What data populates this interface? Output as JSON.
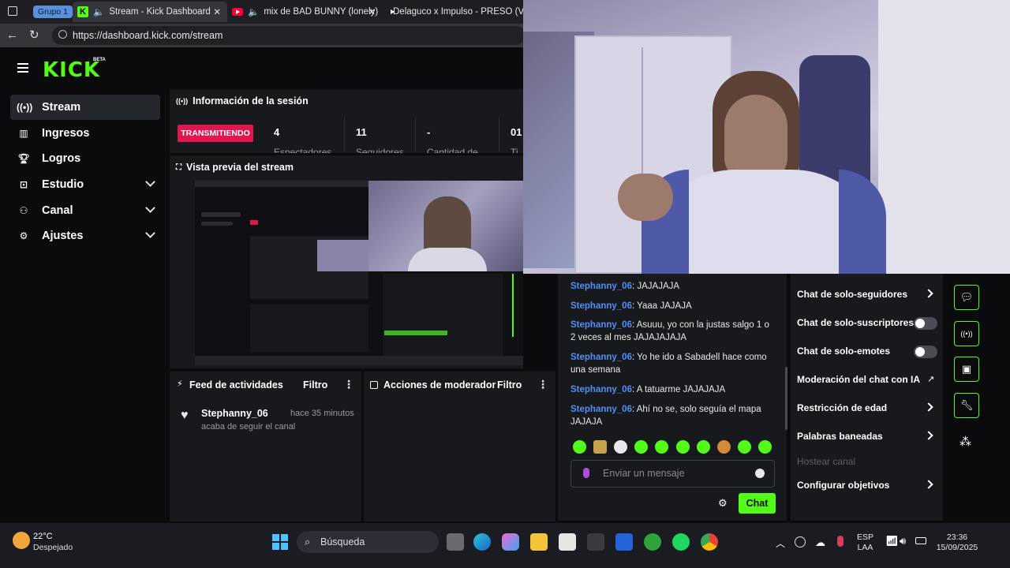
{
  "browser": {
    "group_label": "Grupo 1",
    "tabs": [
      {
        "title": "Stream - Kick Dashboard",
        "active": true
      },
      {
        "title": "mix de BAD BUNNY (lonely)"
      },
      {
        "title": "Delaguco x Impulso - PRESO (Vid"
      }
    ],
    "url": "https://dashboard.kick.com/stream"
  },
  "brand": {
    "logo": "KICK",
    "beta": "BETA",
    "accent": "#53fc18"
  },
  "sidebar": {
    "items": [
      {
        "label": "Stream",
        "icon": "broadcast-icon"
      },
      {
        "label": "Ingresos",
        "icon": "chart-icon"
      },
      {
        "label": "Logros",
        "icon": "trophy-icon"
      },
      {
        "label": "Estudio",
        "icon": "studio-icon"
      },
      {
        "label": "Canal",
        "icon": "channel-icon"
      },
      {
        "label": "Ajustes",
        "icon": "gear-icon"
      }
    ]
  },
  "session": {
    "title": "Información de la sesión",
    "status": "TRANSMITIENDO",
    "stats": [
      {
        "value": "4",
        "label": "Espectadores"
      },
      {
        "value": "11",
        "label": "Seguidores"
      },
      {
        "value": "-",
        "label": "Cantidad de"
      },
      {
        "value": "01",
        "label": "Ti"
      }
    ]
  },
  "preview": {
    "title": "Vista previa del stream"
  },
  "feed": {
    "title": "Feed de actividades",
    "filter": "Filtro",
    "items": [
      {
        "user": "Stephanny_06",
        "time": "hace 35 minutos",
        "text": "acaba de seguir el canal"
      }
    ]
  },
  "moderator": {
    "title": "Acciones de moderador",
    "filter": "Filtro"
  },
  "chat": {
    "messages": [
      {
        "user": "Stephanny_06",
        "text": ": JAJAJAJA"
      },
      {
        "user": "Stephanny_06",
        "text": ": Yaaa JAJAJA"
      },
      {
        "user": "Stephanny_06",
        "text": ": Asuuu, yo con la justas salgo 1 o 2 veces al mes JAJAJAJAJA"
      },
      {
        "user": "Stephanny_06",
        "text": ": Yo he ido a Sabadell hace como una semana"
      },
      {
        "user": "Stephanny_06",
        "text": ": A tatuarme JAJAJAJA"
      },
      {
        "user": "Stephanny_06",
        "text": ": Ahí no se, solo seguía el mapa JAJAJA"
      }
    ],
    "placeholder": "Enviar un mensaje",
    "send_label": "Chat"
  },
  "settings": {
    "items": [
      {
        "label": "Chat de solo-seguidores",
        "control": "arrow"
      },
      {
        "label": "Chat de solo-suscriptores",
        "control": "toggle"
      },
      {
        "label": "Chat de solo-emotes",
        "control": "toggle"
      },
      {
        "label": "Moderación del chat con IA",
        "control": "external"
      },
      {
        "label": "Restricción de edad",
        "control": "arrow"
      },
      {
        "label": "Palabras baneadas",
        "control": "arrow"
      },
      {
        "label": "Hostear canal",
        "control": "none"
      },
      {
        "label": "Configurar objetivos",
        "control": "arrow"
      }
    ]
  },
  "taskbar": {
    "weather_temp": "22°C",
    "weather_desc": "Despejado",
    "search": "Búsqueda",
    "lang_line1": "ESP",
    "lang_line2": "LAA",
    "time": "23:36",
    "date": "15/09/2025"
  }
}
